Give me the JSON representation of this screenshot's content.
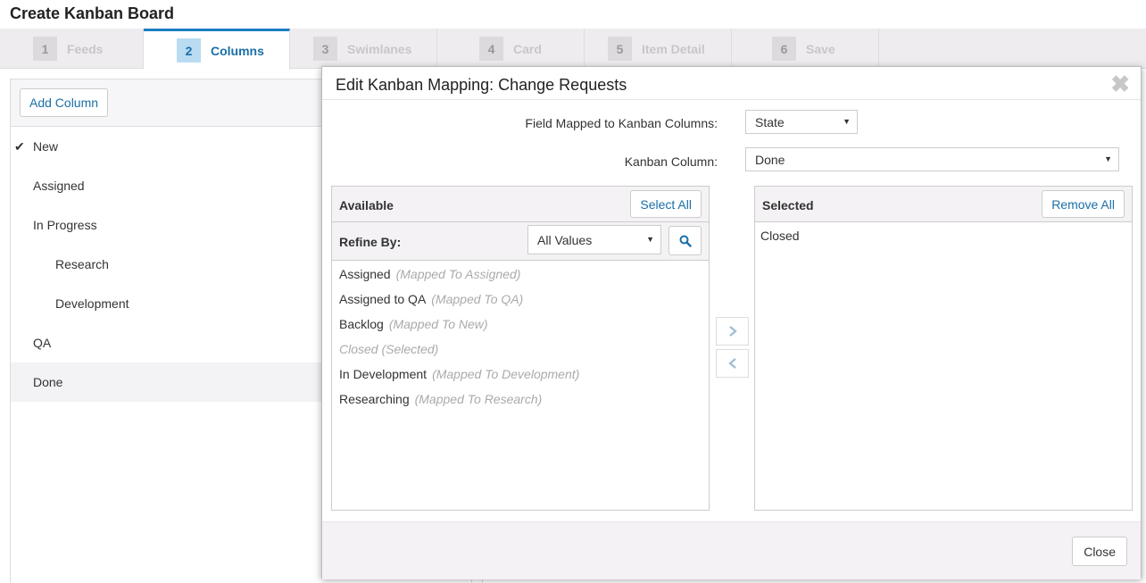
{
  "page": {
    "title": "Create Kanban Board"
  },
  "tabs": [
    {
      "num": "1",
      "label": "Feeds"
    },
    {
      "num": "2",
      "label": "Columns"
    },
    {
      "num": "3",
      "label": "Swimlanes"
    },
    {
      "num": "4",
      "label": "Card"
    },
    {
      "num": "5",
      "label": "Item Detail"
    },
    {
      "num": "6",
      "label": "Save"
    }
  ],
  "left": {
    "add_button": "Add Column",
    "columns": [
      {
        "label": "New",
        "checked": true
      },
      {
        "label": "Assigned"
      },
      {
        "label": "In Progress"
      },
      {
        "label": "Research"
      },
      {
        "label": "Development"
      },
      {
        "label": "QA"
      },
      {
        "label": "Done"
      }
    ]
  },
  "modal": {
    "title": "Edit Kanban Mapping: Change Requests",
    "field_label": "Field Mapped to Kanban Columns:",
    "field_value": "State",
    "column_label": "Kanban Column:",
    "column_value": "Done",
    "available": {
      "header": "Available",
      "select_all": "Select All",
      "refine_label": "Refine By:",
      "refine_value": "All Values",
      "items": [
        {
          "name": "Assigned",
          "mapped": "(Mapped To Assigned)"
        },
        {
          "name": "Assigned to QA",
          "mapped": "(Mapped To QA)"
        },
        {
          "name": "Backlog",
          "mapped": "(Mapped To New)"
        },
        {
          "name": "Closed (Selected)",
          "mapped": ""
        },
        {
          "name": "In Development",
          "mapped": "(Mapped To Development)"
        },
        {
          "name": "Researching",
          "mapped": "(Mapped To Research)"
        }
      ]
    },
    "selected": {
      "header": "Selected",
      "remove_all": "Remove All",
      "items": [
        "Closed"
      ]
    },
    "close_button": "Close"
  }
}
